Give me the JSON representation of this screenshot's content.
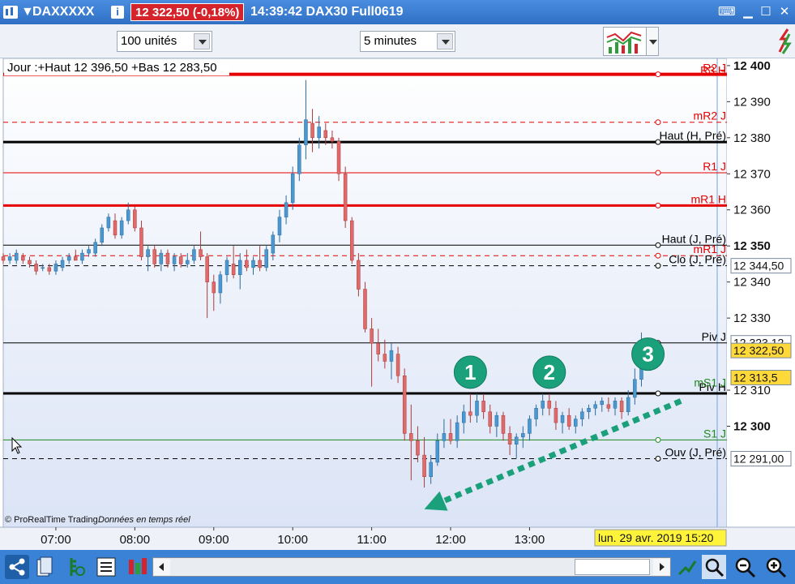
{
  "titlebar": {
    "instrument": "DAXXXXX",
    "price_badge": "12 322,50 (-0,18%)",
    "time_label": "14:39:42 DAX30 Full0619",
    "colors": {
      "bar": "#2f6fc4",
      "badge": "#d4232b"
    }
  },
  "toolbar": {
    "units_select": "100 unités",
    "period_select": "5 minutes"
  },
  "chart_data": {
    "type": "candlestick",
    "info_text": "Jour :+Haut 12 396,50 +Bas 12 283,50",
    "copyright": "© ProRealTime Trading",
    "realtime_note": "Données en temps réel",
    "date_badge": "lun. 29 avr. 2019 15:20",
    "ylim": [
      12272,
      12402
    ],
    "xlim": [
      "06:20",
      "15:30"
    ],
    "y_ticks": [
      "12 400",
      "12 390",
      "12 380",
      "12 370",
      "12 360",
      "12 350",
      "12 340",
      "12 330",
      "12 310",
      "12 300"
    ],
    "y_tick_values": [
      12400,
      12390,
      12380,
      12370,
      12360,
      12350,
      12340,
      12330,
      12310,
      12300
    ],
    "x_ticks": [
      "07:00",
      "08:00",
      "09:00",
      "10:00",
      "11:00",
      "12:00",
      "13:00"
    ],
    "levels": [
      {
        "label": "R2 J",
        "value": 12397.6,
        "style": "solid",
        "width": 4,
        "color": "#e60000"
      },
      {
        "label": "R3 H",
        "value": 12396.9,
        "style": "none",
        "width": 0,
        "color": "#e60000"
      },
      {
        "label": "mR2 J",
        "value": 12384.3,
        "style": "dashed",
        "width": 1,
        "color": "#e60000"
      },
      {
        "label": "Haut (H, Pré)",
        "value": 12378.8,
        "style": "solid",
        "width": 3,
        "color": "#000000"
      },
      {
        "label": "R1 J",
        "value": 12370.3,
        "style": "solid",
        "width": 1,
        "color": "#e60000"
      },
      {
        "label": "mR1 H",
        "value": 12361.2,
        "style": "solid",
        "width": 3,
        "color": "#e60000"
      },
      {
        "label": "Haut (J, Pré)",
        "value": 12350.2,
        "style": "solid",
        "width": 1,
        "color": "#000000"
      },
      {
        "label": "mR1 J",
        "value": 12347.3,
        "style": "dashed",
        "width": 1,
        "color": "#e60000"
      },
      {
        "label": "Clo (J, Pré)",
        "value": 12344.5,
        "style": "dashed",
        "width": 1,
        "color": "#000000"
      },
      {
        "label": "Piv J",
        "value": 12323.1,
        "style": "solid",
        "width": 1,
        "color": "#000000"
      },
      {
        "label": "Piv H",
        "value": 12309.1,
        "style": "solid",
        "width": 3,
        "color": "#000000"
      },
      {
        "label": "mS1 J",
        "value": 12310.3,
        "style": "none",
        "width": 0,
        "color": "#1f8a1f"
      },
      {
        "label": "S1 J",
        "value": 12296.2,
        "style": "solid",
        "width": 1,
        "color": "#1f8a1f"
      },
      {
        "label": "Ouv (J, Pré)",
        "value": 12291.0,
        "style": "dashed",
        "width": 1,
        "color": "#000000"
      }
    ],
    "price_boxes": [
      {
        "label": "12 344,50",
        "value": 12344.5,
        "kind": "level"
      },
      {
        "label": "12 323,12",
        "value": 12323.12,
        "kind": "level"
      },
      {
        "label": "12 322,50",
        "value": 12321.0,
        "kind": "last"
      },
      {
        "label": "12 313,5",
        "value": 12313.5,
        "kind": "last"
      },
      {
        "label": "12 291,00",
        "value": 12291.0,
        "kind": "level"
      }
    ],
    "markers": [
      {
        "label": "1",
        "time": "12:15",
        "price": 12315
      },
      {
        "label": "2",
        "time": "13:15",
        "price": 12315
      },
      {
        "label": "3",
        "time": "14:30",
        "price": 12320
      }
    ],
    "trend_arrow": {
      "from": {
        "time": "14:55",
        "price": 12307
      },
      "to": {
        "time": "11:40",
        "price": 12277
      }
    },
    "candles": [
      {
        "t": "06:20",
        "o": 12347,
        "h": 12348,
        "l": 12345,
        "c": 12346
      },
      {
        "t": "06:25",
        "o": 12346,
        "h": 12348,
        "l": 12345,
        "c": 12347
      },
      {
        "t": "06:30",
        "o": 12346,
        "h": 12349,
        "l": 12345,
        "c": 12348
      },
      {
        "t": "06:35",
        "o": 12347,
        "h": 12348,
        "l": 12345,
        "c": 12346
      },
      {
        "t": "06:40",
        "o": 12346,
        "h": 12347,
        "l": 12344,
        "c": 12345
      },
      {
        "t": "06:45",
        "o": 12345,
        "h": 12346,
        "l": 12342,
        "c": 12343
      },
      {
        "t": "06:50",
        "o": 12344,
        "h": 12345,
        "l": 12343,
        "c": 12344
      },
      {
        "t": "06:55",
        "o": 12344,
        "h": 12345,
        "l": 12342,
        "c": 12343
      },
      {
        "t": "07:00",
        "o": 12343,
        "h": 12346,
        "l": 12342,
        "c": 12345
      },
      {
        "t": "07:05",
        "o": 12344,
        "h": 12347,
        "l": 12343,
        "c": 12346
      },
      {
        "t": "07:10",
        "o": 12346,
        "h": 12348,
        "l": 12345,
        "c": 12347
      },
      {
        "t": "07:15",
        "o": 12347,
        "h": 12349,
        "l": 12346,
        "c": 12346
      },
      {
        "t": "07:20",
        "o": 12346,
        "h": 12349,
        "l": 12345,
        "c": 12348
      },
      {
        "t": "07:25",
        "o": 12348,
        "h": 12350,
        "l": 12347,
        "c": 12349
      },
      {
        "t": "07:30",
        "o": 12348,
        "h": 12352,
        "l": 12347,
        "c": 12351
      },
      {
        "t": "07:35",
        "o": 12351,
        "h": 12356,
        "l": 12350,
        "c": 12355
      },
      {
        "t": "07:40",
        "o": 12355,
        "h": 12359,
        "l": 12354,
        "c": 12358
      },
      {
        "t": "07:45",
        "o": 12357,
        "h": 12359,
        "l": 12352,
        "c": 12353
      },
      {
        "t": "07:50",
        "o": 12353,
        "h": 12358,
        "l": 12352,
        "c": 12357
      },
      {
        "t": "07:55",
        "o": 12357,
        "h": 12362,
        "l": 12356,
        "c": 12360
      },
      {
        "t": "08:00",
        "o": 12360,
        "h": 12361,
        "l": 12354,
        "c": 12355
      },
      {
        "t": "08:05",
        "o": 12355,
        "h": 12357,
        "l": 12346,
        "c": 12347
      },
      {
        "t": "08:10",
        "o": 12347,
        "h": 12350,
        "l": 12343,
        "c": 12349
      },
      {
        "t": "08:15",
        "o": 12349,
        "h": 12350,
        "l": 12344,
        "c": 12345
      },
      {
        "t": "08:20",
        "o": 12345,
        "h": 12349,
        "l": 12343,
        "c": 12348
      },
      {
        "t": "08:25",
        "o": 12348,
        "h": 12349,
        "l": 12344,
        "c": 12345
      },
      {
        "t": "08:30",
        "o": 12345,
        "h": 12348,
        "l": 12343,
        "c": 12347
      },
      {
        "t": "08:35",
        "o": 12347,
        "h": 12348,
        "l": 12344,
        "c": 12345
      },
      {
        "t": "08:40",
        "o": 12345,
        "h": 12348,
        "l": 12344,
        "c": 12346
      },
      {
        "t": "08:45",
        "o": 12346,
        "h": 12350,
        "l": 12345,
        "c": 12349
      },
      {
        "t": "08:50",
        "o": 12349,
        "h": 12354,
        "l": 12346,
        "c": 12347
      },
      {
        "t": "08:55",
        "o": 12347,
        "h": 12348,
        "l": 12330,
        "c": 12340
      },
      {
        "t": "09:00",
        "o": 12340,
        "h": 12342,
        "l": 12332,
        "c": 12337
      },
      {
        "t": "09:05",
        "o": 12337,
        "h": 12343,
        "l": 12334,
        "c": 12342
      },
      {
        "t": "09:10",
        "o": 12342,
        "h": 12347,
        "l": 12340,
        "c": 12346
      },
      {
        "t": "09:15",
        "o": 12345,
        "h": 12350,
        "l": 12341,
        "c": 12342
      },
      {
        "t": "09:20",
        "o": 12342,
        "h": 12348,
        "l": 12338,
        "c": 12346
      },
      {
        "t": "09:25",
        "o": 12346,
        "h": 12349,
        "l": 12343,
        "c": 12344
      },
      {
        "t": "09:30",
        "o": 12344,
        "h": 12347,
        "l": 12342,
        "c": 12346
      },
      {
        "t": "09:35",
        "o": 12346,
        "h": 12350,
        "l": 12343,
        "c": 12344
      },
      {
        "t": "09:40",
        "o": 12344,
        "h": 12350,
        "l": 12343,
        "c": 12349
      },
      {
        "t": "09:45",
        "o": 12348,
        "h": 12354,
        "l": 12346,
        "c": 12353
      },
      {
        "t": "09:50",
        "o": 12353,
        "h": 12360,
        "l": 12351,
        "c": 12358
      },
      {
        "t": "09:55",
        "o": 12358,
        "h": 12364,
        "l": 12356,
        "c": 12362
      },
      {
        "t": "10:00",
        "o": 12362,
        "h": 12372,
        "l": 12360,
        "c": 12370
      },
      {
        "t": "10:05",
        "o": 12370,
        "h": 12380,
        "l": 12368,
        "c": 12378
      },
      {
        "t": "10:10",
        "o": 12378,
        "h": 12396,
        "l": 12374,
        "c": 12385
      },
      {
        "t": "10:15",
        "o": 12384,
        "h": 12388,
        "l": 12376,
        "c": 12380
      },
      {
        "t": "10:20",
        "o": 12380,
        "h": 12386,
        "l": 12377,
        "c": 12383
      },
      {
        "t": "10:25",
        "o": 12382,
        "h": 12384,
        "l": 12378,
        "c": 12380
      },
      {
        "t": "10:30",
        "o": 12380,
        "h": 12382,
        "l": 12377,
        "c": 12379
      },
      {
        "t": "10:35",
        "o": 12379,
        "h": 12380,
        "l": 12368,
        "c": 12370
      },
      {
        "t": "10:40",
        "o": 12370,
        "h": 12372,
        "l": 12355,
        "c": 12357
      },
      {
        "t": "10:45",
        "o": 12357,
        "h": 12358,
        "l": 12345,
        "c": 12346
      },
      {
        "t": "10:50",
        "o": 12346,
        "h": 12348,
        "l": 12336,
        "c": 12338
      },
      {
        "t": "10:55",
        "o": 12338,
        "h": 12340,
        "l": 12326,
        "c": 12327
      },
      {
        "t": "11:00",
        "o": 12327,
        "h": 12330,
        "l": 12311,
        "c": 12323
      },
      {
        "t": "11:05",
        "o": 12323,
        "h": 12327,
        "l": 12318,
        "c": 12320
      },
      {
        "t": "11:10",
        "o": 12320,
        "h": 12324,
        "l": 12316,
        "c": 12318
      },
      {
        "t": "11:15",
        "o": 12318,
        "h": 12323,
        "l": 12313,
        "c": 12321
      },
      {
        "t": "11:20",
        "o": 12320,
        "h": 12322,
        "l": 12312,
        "c": 12314
      },
      {
        "t": "11:25",
        "o": 12314,
        "h": 12316,
        "l": 12296,
        "c": 12298
      },
      {
        "t": "11:30",
        "o": 12298,
        "h": 12306,
        "l": 12285,
        "c": 12296
      },
      {
        "t": "11:35",
        "o": 12296,
        "h": 12300,
        "l": 12290,
        "c": 12292
      },
      {
        "t": "11:40",
        "o": 12292,
        "h": 12297,
        "l": 12283,
        "c": 12286
      },
      {
        "t": "11:45",
        "o": 12286,
        "h": 12292,
        "l": 12284,
        "c": 12290
      },
      {
        "t": "11:50",
        "o": 12290,
        "h": 12298,
        "l": 12289,
        "c": 12296
      },
      {
        "t": "11:55",
        "o": 12296,
        "h": 12302,
        "l": 12294,
        "c": 12298
      },
      {
        "t": "12:00",
        "o": 12298,
        "h": 12302,
        "l": 12295,
        "c": 12296
      },
      {
        "t": "12:05",
        "o": 12296,
        "h": 12303,
        "l": 12294,
        "c": 12301
      },
      {
        "t": "12:10",
        "o": 12301,
        "h": 12306,
        "l": 12298,
        "c": 12304
      },
      {
        "t": "12:15",
        "o": 12304,
        "h": 12309,
        "l": 12301,
        "c": 12303
      },
      {
        "t": "12:20",
        "o": 12303,
        "h": 12309,
        "l": 12301,
        "c": 12307
      },
      {
        "t": "12:25",
        "o": 12307,
        "h": 12309,
        "l": 12302,
        "c": 12304
      },
      {
        "t": "12:30",
        "o": 12304,
        "h": 12306,
        "l": 12298,
        "c": 12300
      },
      {
        "t": "12:35",
        "o": 12300,
        "h": 12304,
        "l": 12297,
        "c": 12303
      },
      {
        "t": "12:40",
        "o": 12303,
        "h": 12304,
        "l": 12296,
        "c": 12298
      },
      {
        "t": "12:45",
        "o": 12298,
        "h": 12300,
        "l": 12292,
        "c": 12295
      },
      {
        "t": "12:50",
        "o": 12295,
        "h": 12298,
        "l": 12291,
        "c": 12297
      },
      {
        "t": "12:55",
        "o": 12297,
        "h": 12300,
        "l": 12294,
        "c": 12298
      },
      {
        "t": "13:00",
        "o": 12298,
        "h": 12303,
        "l": 12296,
        "c": 12302
      },
      {
        "t": "13:05",
        "o": 12302,
        "h": 12306,
        "l": 12300,
        "c": 12305
      },
      {
        "t": "13:10",
        "o": 12305,
        "h": 12309,
        "l": 12303,
        "c": 12307
      },
      {
        "t": "13:15",
        "o": 12307,
        "h": 12309,
        "l": 12303,
        "c": 12305
      },
      {
        "t": "13:20",
        "o": 12305,
        "h": 12307,
        "l": 12299,
        "c": 12301
      },
      {
        "t": "13:25",
        "o": 12301,
        "h": 12304,
        "l": 12298,
        "c": 12303
      },
      {
        "t": "13:30",
        "o": 12303,
        "h": 12305,
        "l": 12299,
        "c": 12300
      },
      {
        "t": "13:35",
        "o": 12300,
        "h": 12303,
        "l": 12298,
        "c": 12302
      },
      {
        "t": "13:40",
        "o": 12302,
        "h": 12305,
        "l": 12300,
        "c": 12304
      },
      {
        "t": "13:45",
        "o": 12304,
        "h": 12306,
        "l": 12302,
        "c": 12305
      },
      {
        "t": "13:50",
        "o": 12305,
        "h": 12307,
        "l": 12303,
        "c": 12306
      },
      {
        "t": "13:55",
        "o": 12306,
        "h": 12308,
        "l": 12304,
        "c": 12307
      },
      {
        "t": "14:00",
        "o": 12306,
        "h": 12308,
        "l": 12304,
        "c": 12305
      },
      {
        "t": "14:05",
        "o": 12305,
        "h": 12308,
        "l": 12303,
        "c": 12307
      },
      {
        "t": "14:10",
        "o": 12307,
        "h": 12308,
        "l": 12302,
        "c": 12304
      },
      {
        "t": "14:15",
        "o": 12304,
        "h": 12310,
        "l": 12303,
        "c": 12308
      },
      {
        "t": "14:20",
        "o": 12308,
        "h": 12316,
        "l": 12306,
        "c": 12313
      },
      {
        "t": "14:25",
        "o": 12313,
        "h": 12326,
        "l": 12311,
        "c": 12322.5
      }
    ]
  },
  "bottombar": {
    "colors": {
      "bar": "#3a82d6"
    }
  }
}
